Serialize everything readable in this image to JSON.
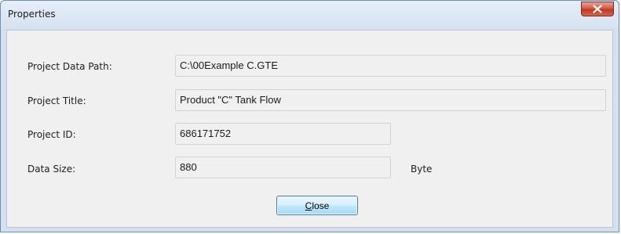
{
  "window": {
    "title": "Properties"
  },
  "fields": [
    {
      "label": "Project Data Path:",
      "value": "C:\\00Example C.GTE"
    },
    {
      "label": "Project Title:",
      "value": "Product \"C\" Tank Flow"
    },
    {
      "label": "Project ID:",
      "value": "686171752"
    },
    {
      "label": "Data Size:",
      "value": "880",
      "unit": "Byte"
    }
  ],
  "buttons": {
    "close_mnemonic": "C",
    "close_rest": "lose"
  },
  "icons": {
    "title_close": "close-icon"
  },
  "colors": {
    "window_frame": "#d9e4f2",
    "close_button_red": "#c2361f",
    "button_focus_border": "#3c7fb1",
    "client_background": "#f0f0f0"
  }
}
